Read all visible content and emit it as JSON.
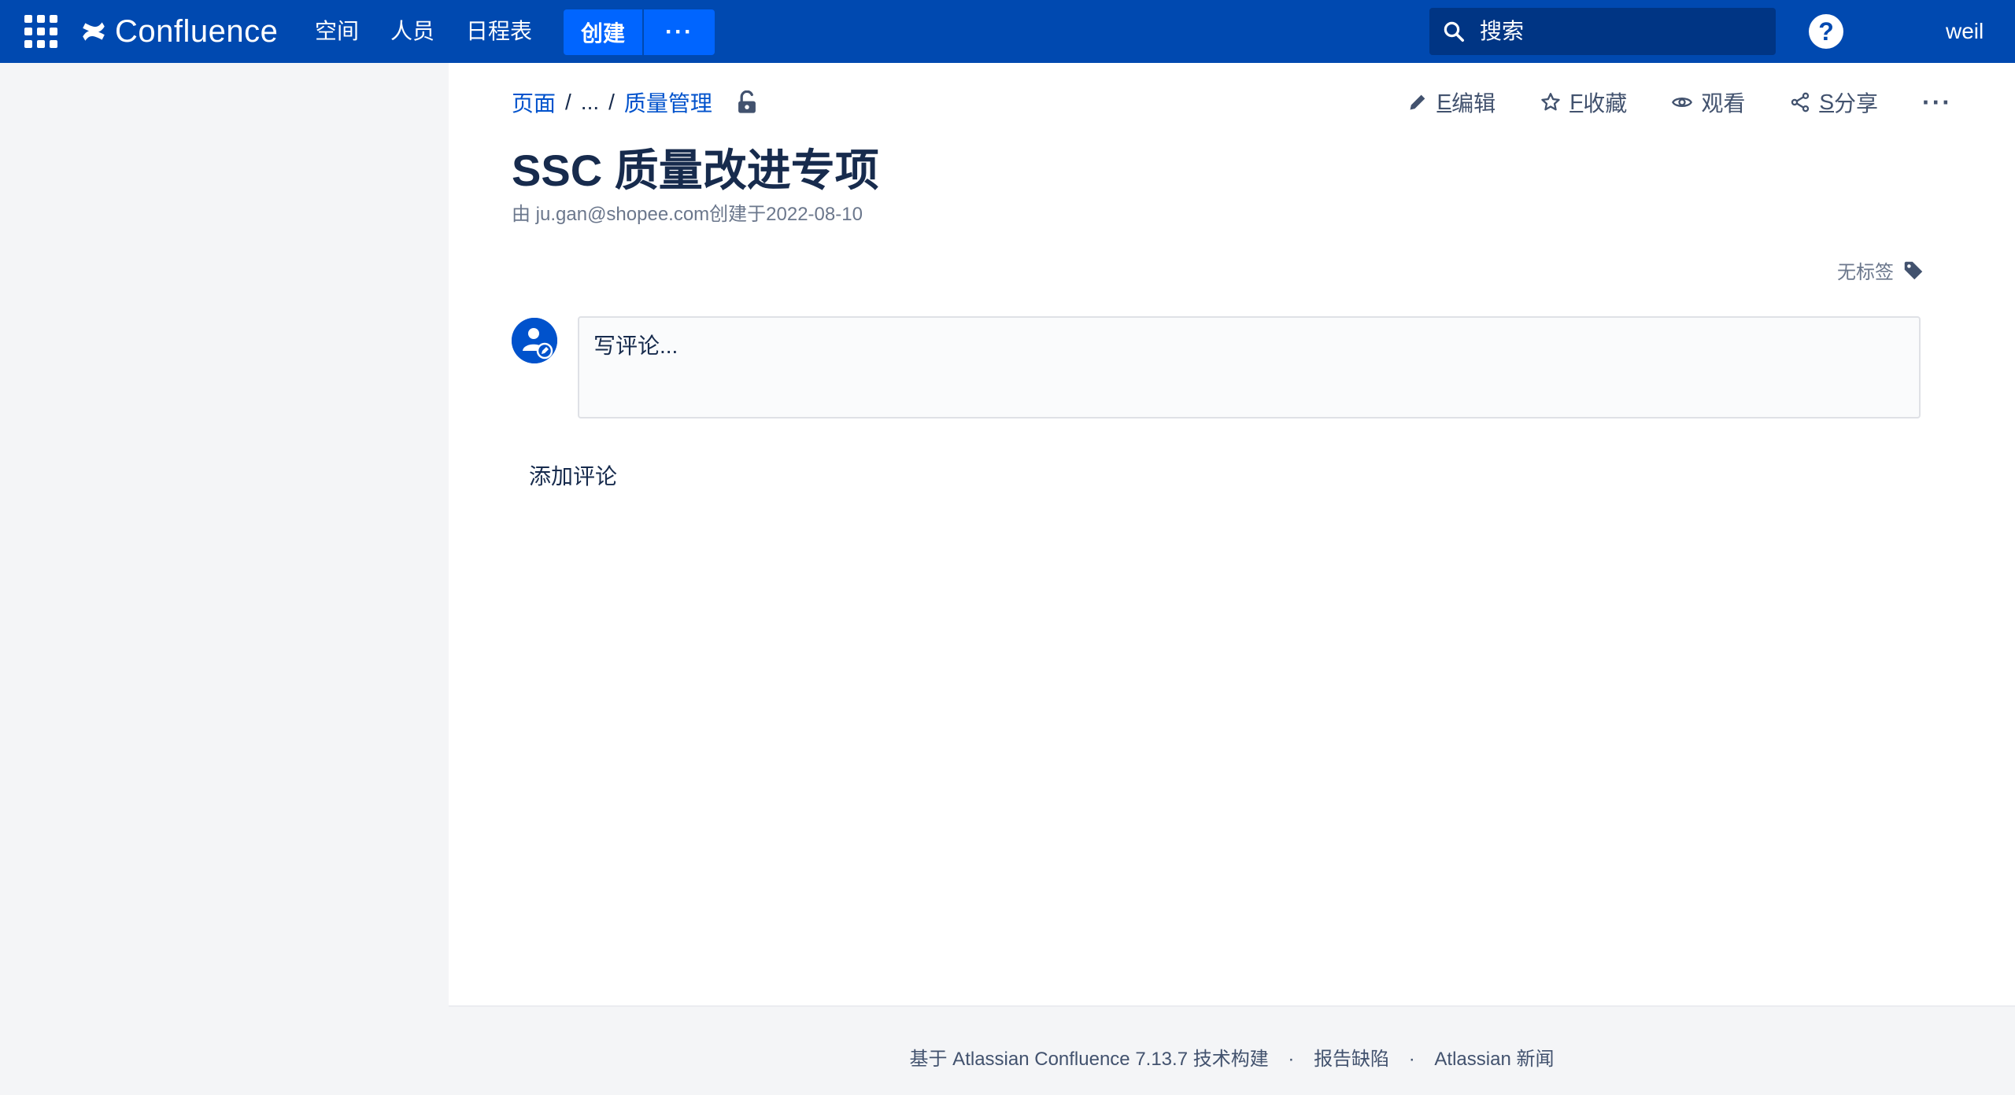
{
  "header": {
    "logo_text": "Confluence",
    "nav": {
      "spaces": "空间",
      "people": "人员",
      "calendar": "日程表"
    },
    "create_label": "创建",
    "more_label": "···",
    "search": {
      "placeholder": "搜索"
    },
    "help_label": "?",
    "user_name": "weil"
  },
  "breadcrumb": {
    "root": "页面",
    "separator": "/",
    "ellipsis": "...",
    "parent": "质量管理"
  },
  "actions": {
    "edit_key": "E",
    "edit_label": "编辑",
    "star_key": "F",
    "star_label": "收藏",
    "watch_label": "观看",
    "share_key": "S",
    "share_label": "分享",
    "more_label": "···"
  },
  "page": {
    "title": "SSC 质量改进专项",
    "byline_prefix": "由 ",
    "author": "ju.gan@shopee.com",
    "byline_suffix": "创建于2022-08-10",
    "labels_text": "无标签"
  },
  "comments": {
    "placeholder": "写评论...",
    "add_label": "添加评论"
  },
  "footer": {
    "powered_by": "基于 Atlassian Confluence 7.13.7 技术构建",
    "report_bug": "报告缺陷",
    "news": "Atlassian 新闻",
    "dot": "·"
  },
  "colors": {
    "header_bg": "#0049b0",
    "create_button": "#0065ff",
    "search_bg": "#003584",
    "link": "#0052cc"
  }
}
